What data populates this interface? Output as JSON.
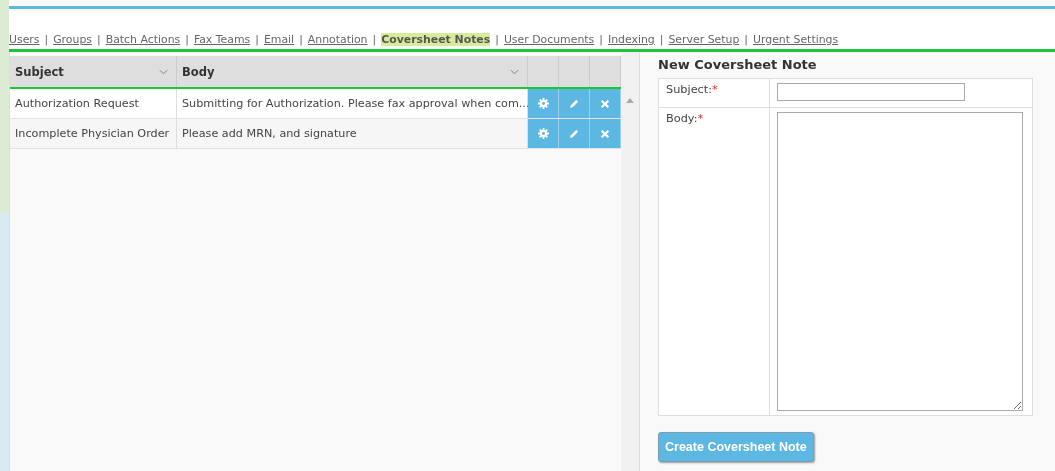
{
  "nav": [
    {
      "label": "Users",
      "selected": false
    },
    {
      "separator": "|",
      "label": "Groups",
      "selected": false
    },
    {
      "separator": "|",
      "label": "Batch Actions",
      "selected": false
    },
    {
      "separator": "|",
      "label": "Fax Teams",
      "selected": false
    },
    {
      "separator": "|",
      "label": "Email",
      "selected": false
    },
    {
      "separator": "|",
      "label": "Annotation",
      "selected": false
    },
    {
      "separator": "|",
      "label": "Coversheet Notes",
      "selected": true
    },
    {
      "separator": "|",
      "label": "User Documents",
      "selected": false
    },
    {
      "separator": "|",
      "label": "Indexing",
      "selected": false
    },
    {
      "separator": "|",
      "label": "Server Setup",
      "selected": false
    },
    {
      "separator": "|",
      "label": "Urgent Settings",
      "selected": false
    }
  ],
  "table": {
    "columns": [
      "Subject",
      "Body"
    ],
    "rows": [
      {
        "subject": "Authorization Request",
        "body": "Submitting for Authorization. Please fax approval when com..."
      },
      {
        "subject": "Incomplete Physician Order",
        "body": "Please add MRN, and signature"
      }
    ]
  },
  "form": {
    "title": "New Coversheet Note",
    "fields": [
      {
        "label": "Subject:",
        "required_mark": "*",
        "kind": "input"
      },
      {
        "label": "Body:",
        "required_mark": "*",
        "kind": "textarea"
      }
    ],
    "button": "Create Coversheet Note"
  }
}
